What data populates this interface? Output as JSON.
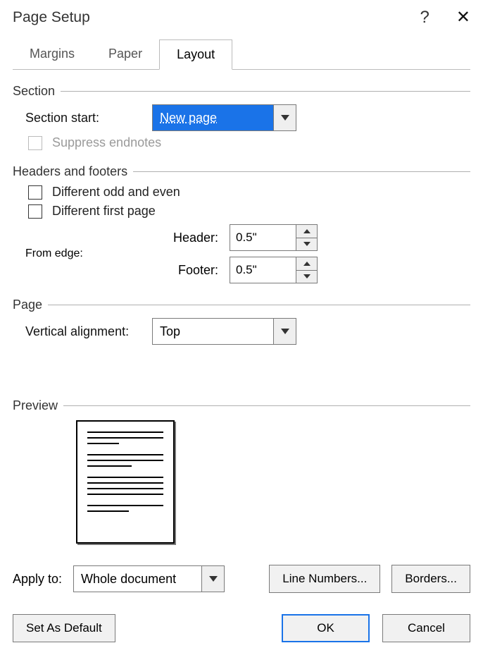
{
  "title": "Page Setup",
  "tabs": [
    "Margins",
    "Paper",
    "Layout"
  ],
  "activeTab": 2,
  "section": {
    "header": "Section",
    "startLabel": "Section start:",
    "startValue": "New page",
    "suppressEndnotes": "Suppress endnotes",
    "suppressChecked": false,
    "suppressDisabled": true
  },
  "hf": {
    "header": "Headers and footers",
    "diffOddEven": "Different odd and even",
    "diffFirstPage": "Different first page",
    "fromEdge": "From edge:",
    "headerLabel": "Header:",
    "footerLabel": "Footer:",
    "headerValue": "0.5\"",
    "footerValue": "0.5\""
  },
  "page": {
    "header": "Page",
    "vAlignLabel": "Vertical alignment:",
    "vAlignValue": "Top"
  },
  "preview": {
    "header": "Preview"
  },
  "apply": {
    "label": "Apply to:",
    "value": "Whole document",
    "lineNumbers": "Line Numbers...",
    "borders": "Borders..."
  },
  "footer": {
    "setDefault": "Set As Default",
    "ok": "OK",
    "cancel": "Cancel"
  }
}
